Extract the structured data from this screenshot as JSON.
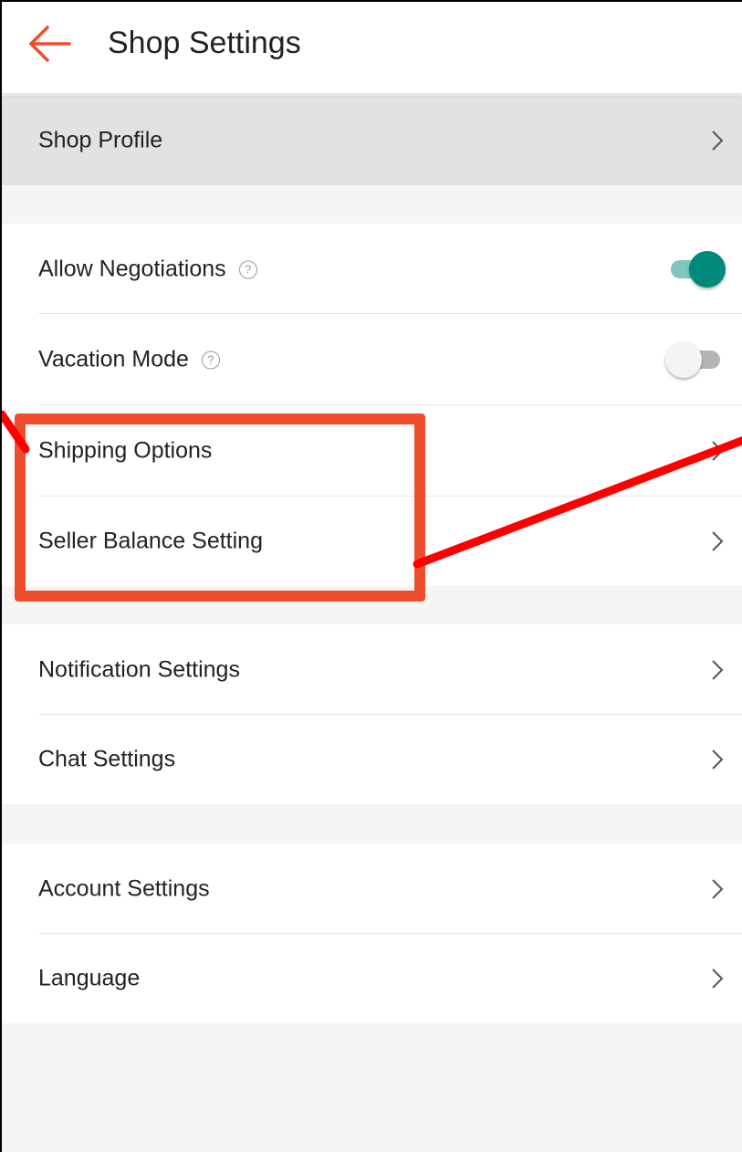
{
  "app_bar": {
    "title": "Shop Settings",
    "back_icon": "arrow-left-icon"
  },
  "rows": [
    {
      "id": "shop-profile",
      "label": "Shop Profile",
      "type": "link",
      "highlighted": true
    },
    {
      "id": "allow-negotiations",
      "label": "Allow Negotiations",
      "type": "toggle",
      "help": "?",
      "enabled": true
    },
    {
      "id": "vacation-mode",
      "label": "Vacation Mode",
      "type": "toggle",
      "help": "?",
      "enabled": false
    },
    {
      "id": "shipping-options",
      "label": "Shipping Options",
      "type": "link"
    },
    {
      "id": "seller-balance-setting",
      "label": "Seller Balance Setting",
      "type": "link"
    },
    {
      "id": "notification-settings",
      "label": "Notification Settings",
      "type": "link"
    },
    {
      "id": "chat-settings",
      "label": "Chat Settings",
      "type": "link"
    },
    {
      "id": "account-settings",
      "label": "Account Settings",
      "type": "link"
    },
    {
      "id": "language",
      "label": "Language",
      "type": "link"
    }
  ],
  "colors": {
    "accent": "#ee4d2d",
    "toggle_on": "#00897b",
    "toggle_on_track": "#7fc6bc",
    "annotation_box": "#ee4d2d",
    "annotation_line": "#ff0000"
  }
}
